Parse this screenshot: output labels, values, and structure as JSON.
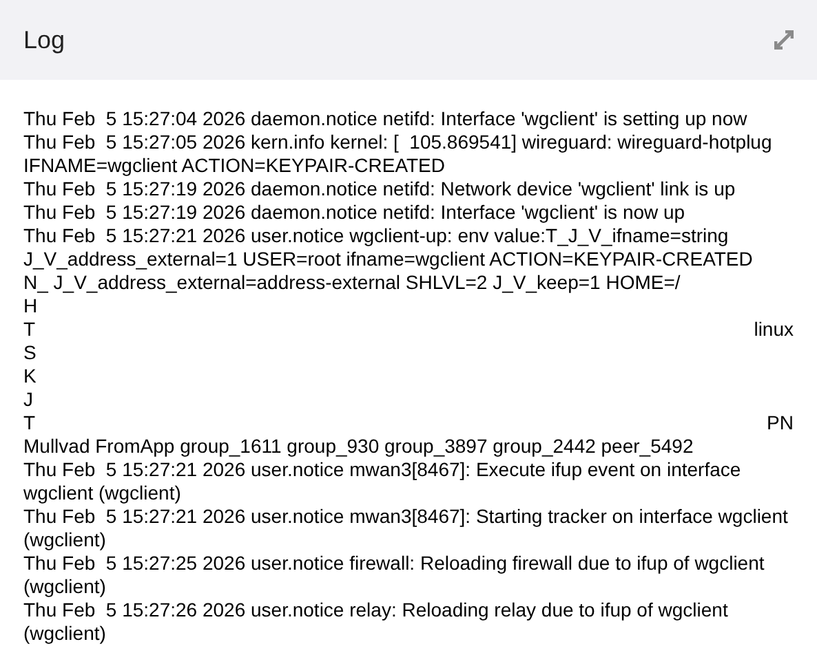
{
  "panel": {
    "title": "Log"
  },
  "entries": [
    {
      "kind": "text",
      "text": "Thu Feb  5 15:27:04 2026 daemon.notice netifd: Interface 'wgclient' is setting up now"
    },
    {
      "kind": "text",
      "text": "Thu Feb  5 15:27:05 2026 kern.info kernel: [  105.869541] wireguard: wireguard-hotplug IFNAME=wgclient ACTION=KEYPAIR-CREATED"
    },
    {
      "kind": "text",
      "text": "Thu Feb  5 15:27:19 2026 daemon.notice netifd: Network device 'wgclient' link is up"
    },
    {
      "kind": "text",
      "text": "Thu Feb  5 15:27:19 2026 daemon.notice netifd: Interface 'wgclient' is now up"
    },
    {
      "kind": "redacted",
      "lines": [
        {
          "left": "Thu Feb  5 15:27:21 2026 user.notice wgclient-up: env value:T_J_V_ifname=string"
        },
        {
          "left": "J_V_address_external=1 USER=root ifname=wgclient ACTION=KEYPAIR-CREATED"
        },
        {
          "left": "N_ J_V_address_external=address-external SHLVL=2 J_V_keep=1 HOME=/"
        },
        {
          "left": "H"
        },
        {
          "left": "T",
          "right": "linux"
        },
        {
          "left": "S"
        },
        {
          "left": "K"
        },
        {
          "left": "J"
        },
        {
          "left": "T",
          "right": "PN"
        },
        {
          "left": "Mullvad FromApp group_1611 group_930 group_3897 group_2442 peer_5492"
        }
      ]
    },
    {
      "kind": "text",
      "text": "Thu Feb  5 15:27:21 2026 user.notice mwan3[8467]: Execute ifup event on interface wgclient (wgclient)"
    },
    {
      "kind": "text",
      "text": "Thu Feb  5 15:27:21 2026 user.notice mwan3[8467]: Starting tracker on interface wgclient (wgclient)"
    },
    {
      "kind": "text",
      "text": "Thu Feb  5 15:27:25 2026 user.notice firewall: Reloading firewall due to ifup of wgclient (wgclient)"
    },
    {
      "kind": "text",
      "text": "Thu Feb  5 15:27:26 2026 user.notice relay: Reloading relay due to ifup of wgclient (wgclient)"
    }
  ]
}
